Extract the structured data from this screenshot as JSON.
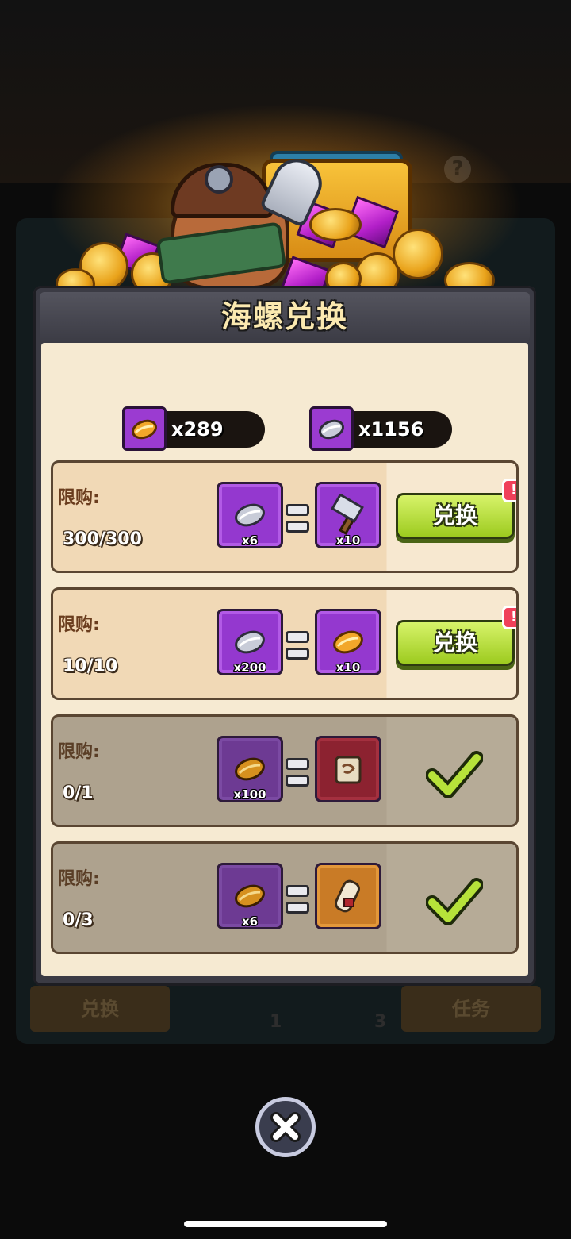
{
  "dialog": {
    "title": "海螺兑换"
  },
  "currencies": [
    {
      "icon": "golden-conch-icon",
      "amount": "x289"
    },
    {
      "icon": "silver-conch-icon",
      "amount": "x1156"
    }
  ],
  "exchanges": [
    {
      "limit_label": "限购:",
      "limit_count": "300/300",
      "cost_icon": "silver-conch-icon",
      "cost_qty": "x6",
      "reward_icon": "hammer-icon",
      "reward_qty": "x10",
      "button_label": "兑换",
      "alert": "!"
    },
    {
      "limit_label": "限购:",
      "limit_count": "10/10",
      "cost_icon": "silver-conch-icon",
      "cost_qty": "x200",
      "reward_icon": "golden-conch-icon",
      "reward_qty": "x10",
      "button_label": "兑换",
      "alert": "!"
    },
    {
      "limit_label": "限购:",
      "limit_count": "0/1",
      "cost_icon": "golden-conch-icon",
      "cost_qty": "x100",
      "reward_icon": "scroll-icon",
      "reward_qty": "",
      "status": "claimed"
    },
    {
      "limit_label": "限购:",
      "limit_count": "0/3",
      "cost_icon": "golden-conch-icon",
      "cost_qty": "x6",
      "reward_icon": "rolled-scroll-icon",
      "reward_qty": "",
      "status": "claimed"
    }
  ],
  "background": {
    "tab_left": "兑换",
    "tab_right": "任务",
    "count_1": "1",
    "count_2": "3"
  },
  "colors": {
    "accent_green": "#9dcb1f",
    "item_purple": "#9438cf",
    "alert_red": "#f0405a",
    "panel_cream": "#f6ead2"
  }
}
